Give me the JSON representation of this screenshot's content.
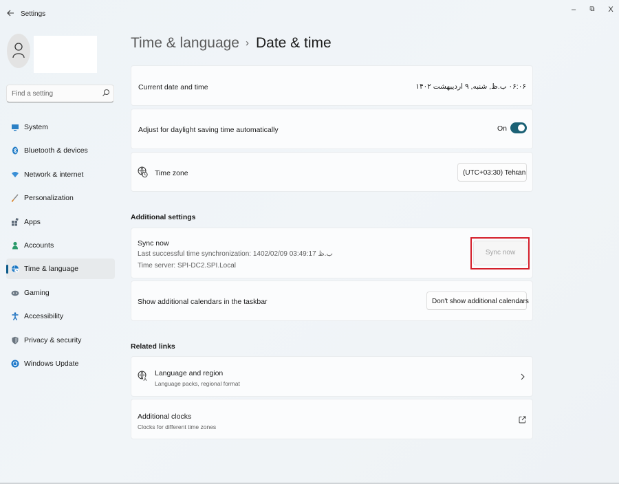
{
  "window": {
    "title": "Settings",
    "back_icon": "back-arrow-icon",
    "controls": {
      "minimize": "–",
      "maximize": "⧉",
      "close": "X"
    }
  },
  "search": {
    "placeholder": "Find a setting"
  },
  "sidebar": {
    "items": [
      {
        "label": "System",
        "icon": "system-icon",
        "color": "#2b80c5"
      },
      {
        "label": "Bluetooth & devices",
        "icon": "bluetooth-icon",
        "color": "#1977c4"
      },
      {
        "label": "Network & internet",
        "icon": "wifi-icon",
        "color": "#3a8fd6"
      },
      {
        "label": "Personalization",
        "icon": "brush-icon",
        "color": "#d9832a"
      },
      {
        "label": "Apps",
        "icon": "apps-icon",
        "color": "#5d6a78"
      },
      {
        "label": "Accounts",
        "icon": "person-icon",
        "color": "#2a9a6a"
      },
      {
        "label": "Time & language",
        "icon": "globe-clock-icon",
        "color": "#1977c4",
        "active": true
      },
      {
        "label": "Gaming",
        "icon": "gamepad-icon",
        "color": "#6e7a86"
      },
      {
        "label": "Accessibility",
        "icon": "accessibility-icon",
        "color": "#1a6fbf"
      },
      {
        "label": "Privacy & security",
        "icon": "shield-icon",
        "color": "#6b7580"
      },
      {
        "label": "Windows Update",
        "icon": "update-icon",
        "color": "#1a76c9"
      }
    ]
  },
  "breadcrumb": {
    "parent": "Time & language",
    "separator": "›",
    "current": "Date & time"
  },
  "current_datetime": {
    "label": "Current date and time",
    "value": "۰۶:۰۶ ب.ظ, شنبه, ۹ اردیبهشت ۱۴۰۲"
  },
  "daylight": {
    "label": "Adjust for daylight saving time automatically",
    "state": "On",
    "accent": "#1b6175"
  },
  "timezone": {
    "label": "Time zone",
    "selected": "(UTC+03:30) Tehran"
  },
  "additional_settings": {
    "title": "Additional settings",
    "sync": {
      "title": "Sync now",
      "last_sync": "Last successful time synchronization: ب.ظ 03:49:17 1402/02/09",
      "server": "Time server: SPI-DC2.SPI.Local",
      "button": "Sync now",
      "highlight_color": "#d41f2a"
    },
    "calendars": {
      "label": "Show additional calendars in the taskbar",
      "selected": "Don't show additional calendars"
    }
  },
  "related_links": {
    "title": "Related links",
    "language": {
      "title": "Language and region",
      "subtitle": "Language packs, regional format"
    },
    "clocks": {
      "title": "Additional clocks",
      "subtitle": "Clocks for different time zones"
    }
  }
}
